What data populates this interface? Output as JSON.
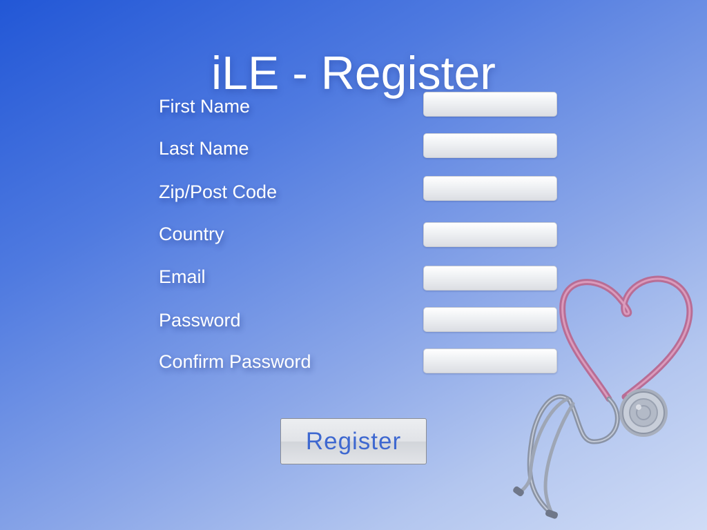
{
  "page": {
    "title": "iLE - Register"
  },
  "form": {
    "fields": [
      {
        "id": "first-name",
        "label": "First Name",
        "value": "",
        "placeholder": ""
      },
      {
        "id": "last-name",
        "label": "Last Name",
        "value": "",
        "placeholder": ""
      },
      {
        "id": "zip-post-code",
        "label": "Zip/Post Code",
        "value": "",
        "placeholder": ""
      },
      {
        "id": "country",
        "label": "Country",
        "value": "",
        "placeholder": ""
      },
      {
        "id": "email",
        "label": "Email",
        "value": "",
        "placeholder": ""
      },
      {
        "id": "password",
        "label": "Password",
        "value": "",
        "placeholder": ""
      },
      {
        "id": "confirm-password",
        "label": "Confirm Password",
        "value": "",
        "placeholder": ""
      }
    ],
    "submit_label": "Register"
  },
  "decoration": {
    "illustration": "heart-stethoscope-icon"
  },
  "colors": {
    "background_top": "#2257d6",
    "background_bottom": "#d0dcf6",
    "label_text": "#ffffff",
    "button_text": "#3e68d0",
    "stethoscope_tube": "#c87ca2",
    "stethoscope_metal": "#8c95a6"
  }
}
